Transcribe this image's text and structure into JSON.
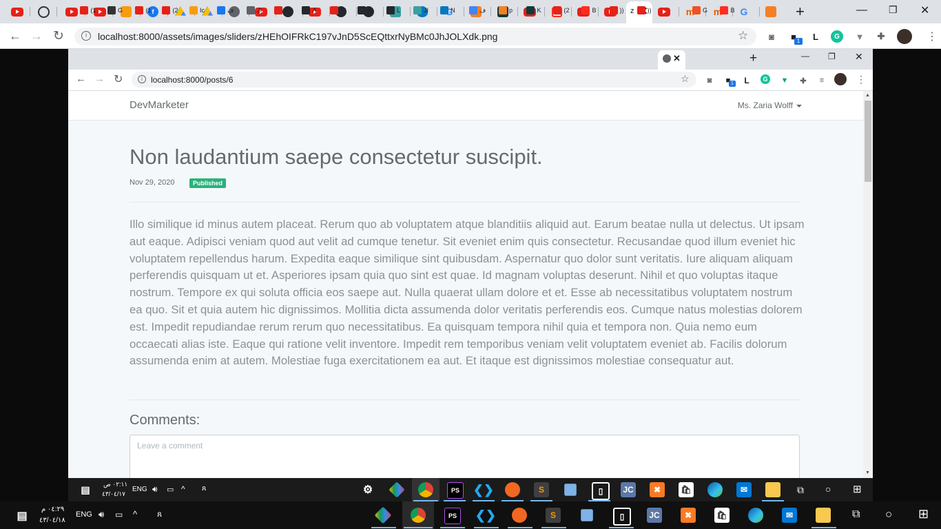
{
  "outer_browser": {
    "active_tab_label": "z",
    "url": "localhost:8000/assets/images/sliders/zHEhOIFRkC197vJnD5ScEQttxrNyBMc0JhJOLXdk.png",
    "profile_letter": "L",
    "extension_badge": "1"
  },
  "inner_browser": {
    "tab_labels": [
      "(1",
      "G",
      "(1",
      "(2",
      "Ic",
      "ف",
      "JI",
      "7)",
      "A",
      "(2",
      "R",
      "L",
      "JI",
      "N",
      "ف",
      "p",
      "K",
      "(2",
      "B",
      "))",
      "))",
      "G",
      "B"
    ],
    "url": "localhost:8000/posts/6",
    "profile_letter": "L",
    "extension_badge": "1"
  },
  "page": {
    "brand": "DevMarketer",
    "user_menu": "Ms. Zaria Wolff",
    "post_title": "Non laudantium saepe consectetur suscipit.",
    "post_date": "Nov 29, 2020",
    "status_badge": "Published",
    "post_body": "Illo similique id minus autem placeat. Rerum quo ab voluptatem atque blanditiis aliquid aut. Earum beatae nulla ut delectus. Ut ipsam aut eaque. Adipisci veniam quod aut velit ad cumque tenetur. Sit eveniet enim quis consectetur. Recusandae quod illum eveniet hic voluptatem repellendus harum. Expedita eaque similique sint quibusdam. Aspernatur quo dolor sunt veritatis. Iure aliquam aliquam perferendis quisquam ut et. Asperiores ipsam quia quo sint est quae. Id magnam voluptas deserunt. Nihil et quo voluptas itaque nostrum. Tempore ex qui soluta officia eos saepe aut. Nulla quaerat ullam dolore et et. Esse ab necessitatibus voluptatem nostrum ea quo. Sit et quia autem hic dignissimos. Mollitia dicta assumenda dolor veritatis perferendis eos. Cumque natus molestias dolorem est. Impedit repudiandae rerum rerum quo necessitatibus. Ea quisquam tempora nihil quia et tempora non. Quia nemo eum occaecati alias iste. Eaque qui ratione velit inventore. Impedit rem temporibus veniam velit voluptatem eveniet ab. Facilis dolorum assumenda enim at autem. Molestiae fuga exercitationem ea aut. Et itaque est dignissimos molestiae consequatur aut.",
    "comments_heading": "Comments:",
    "comment_placeholder": "Leave a comment"
  },
  "inner_taskbar": {
    "time": "٠٢:١١ ص",
    "date": "٤٣/٠٤/١٧",
    "language": "ENG"
  },
  "outer_taskbar": {
    "time": "٠٤:٢٩ م",
    "date": "٤٣/٠٤/١٨",
    "language": "ENG"
  },
  "colors": {
    "badge": "#2ab27b",
    "page_bg": "#f5f8fa",
    "text": "#636b6f",
    "body_text": "#8a9196"
  }
}
